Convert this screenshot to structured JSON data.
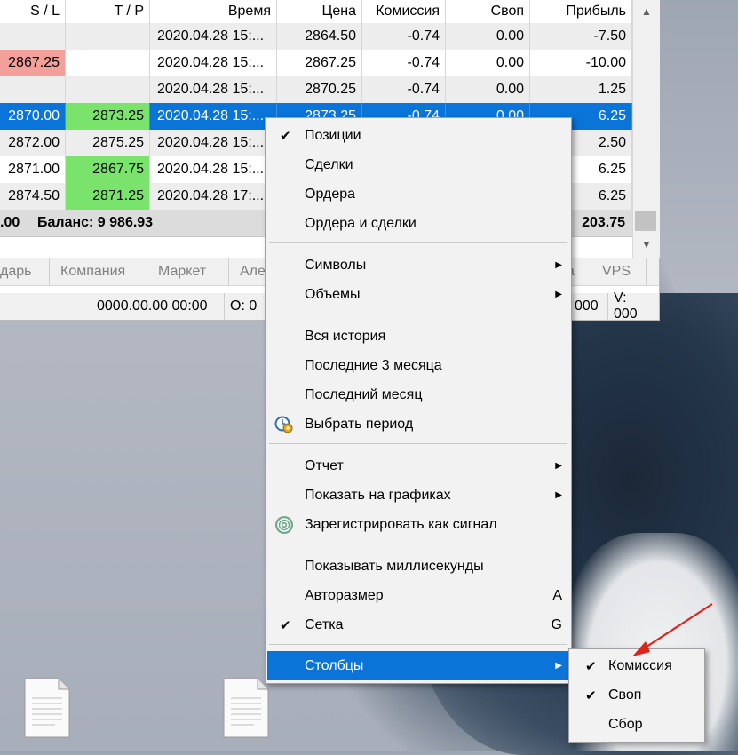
{
  "table": {
    "columns": [
      "S / L",
      "T / P",
      "Время",
      "Цена",
      "Комиссия",
      "Своп",
      "Прибыль"
    ],
    "rows": [
      {
        "sl": "",
        "tp": "",
        "time": "2020.04.28 15:...",
        "price": "2864.50",
        "commission": "-0.74",
        "swap": "0.00",
        "profit": "-7.50"
      },
      {
        "sl": "2867.25",
        "tp": "",
        "time": "2020.04.28 15:...",
        "price": "2867.25",
        "commission": "-0.74",
        "swap": "0.00",
        "profit": "-10.00"
      },
      {
        "sl": "",
        "tp": "",
        "time": "2020.04.28 15:...",
        "price": "2870.25",
        "commission": "-0.74",
        "swap": "0.00",
        "profit": "1.25"
      },
      {
        "sl": "2870.00",
        "tp": "2873.25",
        "time": "2020.04.28 15:...",
        "price": "2873.25",
        "commission": "-0.74",
        "swap": "0.00",
        "profit": "6.25"
      },
      {
        "sl": "2872.00",
        "tp": "2875.25",
        "time": "2020.04.28 15:...",
        "price": "",
        "commission": "",
        "swap": "",
        "profit": "2.50"
      },
      {
        "sl": "2871.00",
        "tp": "2867.75",
        "time": "2020.04.28 15:...",
        "price": "",
        "commission": "",
        "swap": "",
        "profit": "6.25"
      },
      {
        "sl": "2874.50",
        "tp": "2871.25",
        "time": "2020.04.28 17:...",
        "price": "",
        "commission": "",
        "swap": "",
        "profit": "6.25"
      }
    ],
    "balance_left": ".00",
    "balance_label": "Баланс: 9 986.93",
    "balance_profit": "203.75"
  },
  "tabs": [
    "дарь",
    "Компания",
    "Маркет",
    "Але",
    "а",
    "VPS"
  ],
  "statusbar": {
    "time": "0000.00.00 00:00",
    "open": "O: 0",
    "volume_prefix": "000",
    "volume": "V: 000"
  },
  "menu": {
    "items": [
      {
        "label": "Позиции",
        "checked": true
      },
      {
        "label": "Сделки"
      },
      {
        "label": "Ордера"
      },
      {
        "label": "Ордера и сделки"
      },
      {
        "label": "Символы",
        "submenu": true
      },
      {
        "label": "Объемы",
        "submenu": true
      },
      {
        "label": "Вся история"
      },
      {
        "label": "Последние 3 месяца"
      },
      {
        "label": "Последний месяц"
      },
      {
        "label": "Выбрать период",
        "icon": "calendar-gear-icon"
      },
      {
        "label": "Отчет",
        "submenu": true
      },
      {
        "label": "Показать на графиках",
        "submenu": true
      },
      {
        "label": "Зарегистрировать как сигнал",
        "icon": "signal-icon"
      },
      {
        "label": "Показывать миллисекунды"
      },
      {
        "label": "Авторазмер",
        "accel": "A"
      },
      {
        "label": "Сетка",
        "checked": true,
        "accel": "G"
      },
      {
        "label": "Столбцы",
        "submenu": true,
        "highlighted": true
      }
    ]
  },
  "submenu": {
    "items": [
      {
        "label": "Комиссия",
        "checked": true
      },
      {
        "label": "Своп",
        "checked": true
      },
      {
        "label": "Сбор",
        "checked": false
      }
    ]
  },
  "glyphs": {
    "check": "✔",
    "arrow": "▶",
    "up": "▲",
    "down": "▼"
  },
  "colors": {
    "selection": "#0a74d8",
    "sl_red": "#f4a09a",
    "tp_green": "#79e36b",
    "annotation_arrow": "#e0221b"
  }
}
